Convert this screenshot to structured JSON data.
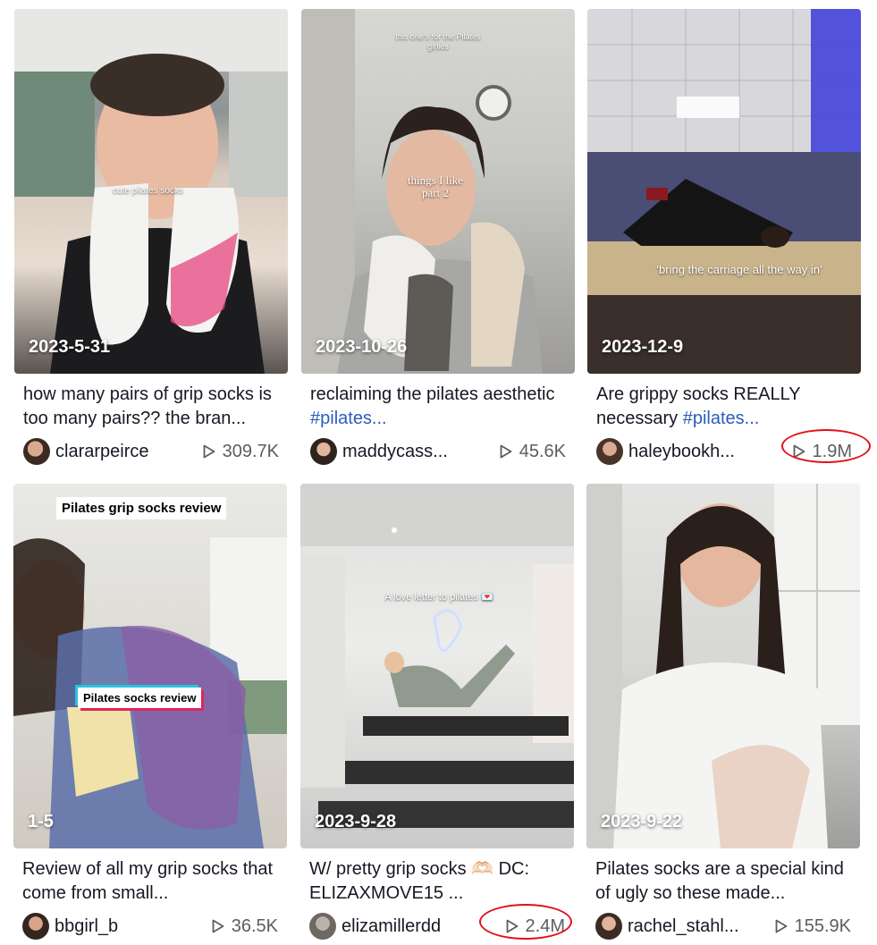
{
  "videos": [
    {
      "date": "2023-5-31",
      "caption": "how many pairs of grip socks is too many pairs?? the bran...",
      "hashtag": "",
      "user": "clararpeirce",
      "views": "309.7K",
      "overlay": "cute pilates socks",
      "highlight": false
    },
    {
      "date": "2023-10-26",
      "caption": "reclaiming the pilates aesthetic",
      "hashtag": "#pilates...",
      "user": "maddycass...",
      "views": "45.6K",
      "overlay": "this one's for the Pilates girlies",
      "overlay2": "things I like part 2",
      "highlight": false
    },
    {
      "date": "2023-12-9",
      "caption": "Are grippy socks REALLY necessary",
      "hashtag": "#pilates...",
      "user": "haleybookh...",
      "views": "1.9M",
      "overlay": "‘bring the carriage all the way in’",
      "highlight": true
    },
    {
      "date": "1-5",
      "caption": "Review of all my grip socks that come from small...",
      "hashtag": "",
      "user": "bbgirl_b",
      "views": "36.5K",
      "overlay": "Pilates grip socks review",
      "overlay2": "Pilates socks review",
      "highlight": false
    },
    {
      "date": "2023-9-28",
      "caption": "W/ pretty grip socks 🫶🏻 DC: ELIZAXMOVE15 ...",
      "hashtag": "",
      "user": "elizamillerdd",
      "views": "2.4M",
      "overlay": "A love letter to pilates 💌",
      "highlight": true
    },
    {
      "date": "2023-9-22",
      "caption": "Pilates socks are a special kind of ugly so these made...",
      "hashtag": "",
      "user": "rachel_stahl...",
      "views": "155.9K",
      "overlay": "",
      "highlight": false
    }
  ],
  "colors": {
    "highlight_ring": "#e0111b",
    "hashtag": "#2b5db9",
    "views": "#5c5d63"
  },
  "icons": {
    "views": "play-icon"
  }
}
